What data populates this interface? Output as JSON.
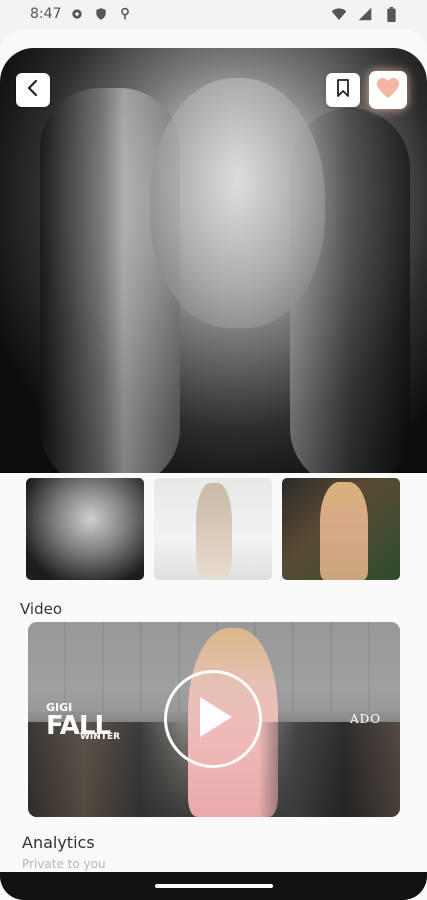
{
  "status_bar": {
    "time": "8:47"
  },
  "hero": {
    "alt": "Portrait photo"
  },
  "toolbar": {
    "back_icon": "back-arrow-icon",
    "bookmark_icon": "bookmark-icon",
    "favorite_icon": "heart-icon",
    "favorite_color": "#F2B6A2"
  },
  "gallery": {
    "thumbnails": [
      "portrait-bw",
      "runway-dress",
      "event-photo"
    ]
  },
  "video_section": {
    "title": "Video",
    "brand_line1": "GIGI",
    "brand_line2": "FALL",
    "brand_line3": "WINTER",
    "watermark": "ADO"
  },
  "analytics": {
    "title": "Analytics",
    "subtitle": "Private to you"
  }
}
